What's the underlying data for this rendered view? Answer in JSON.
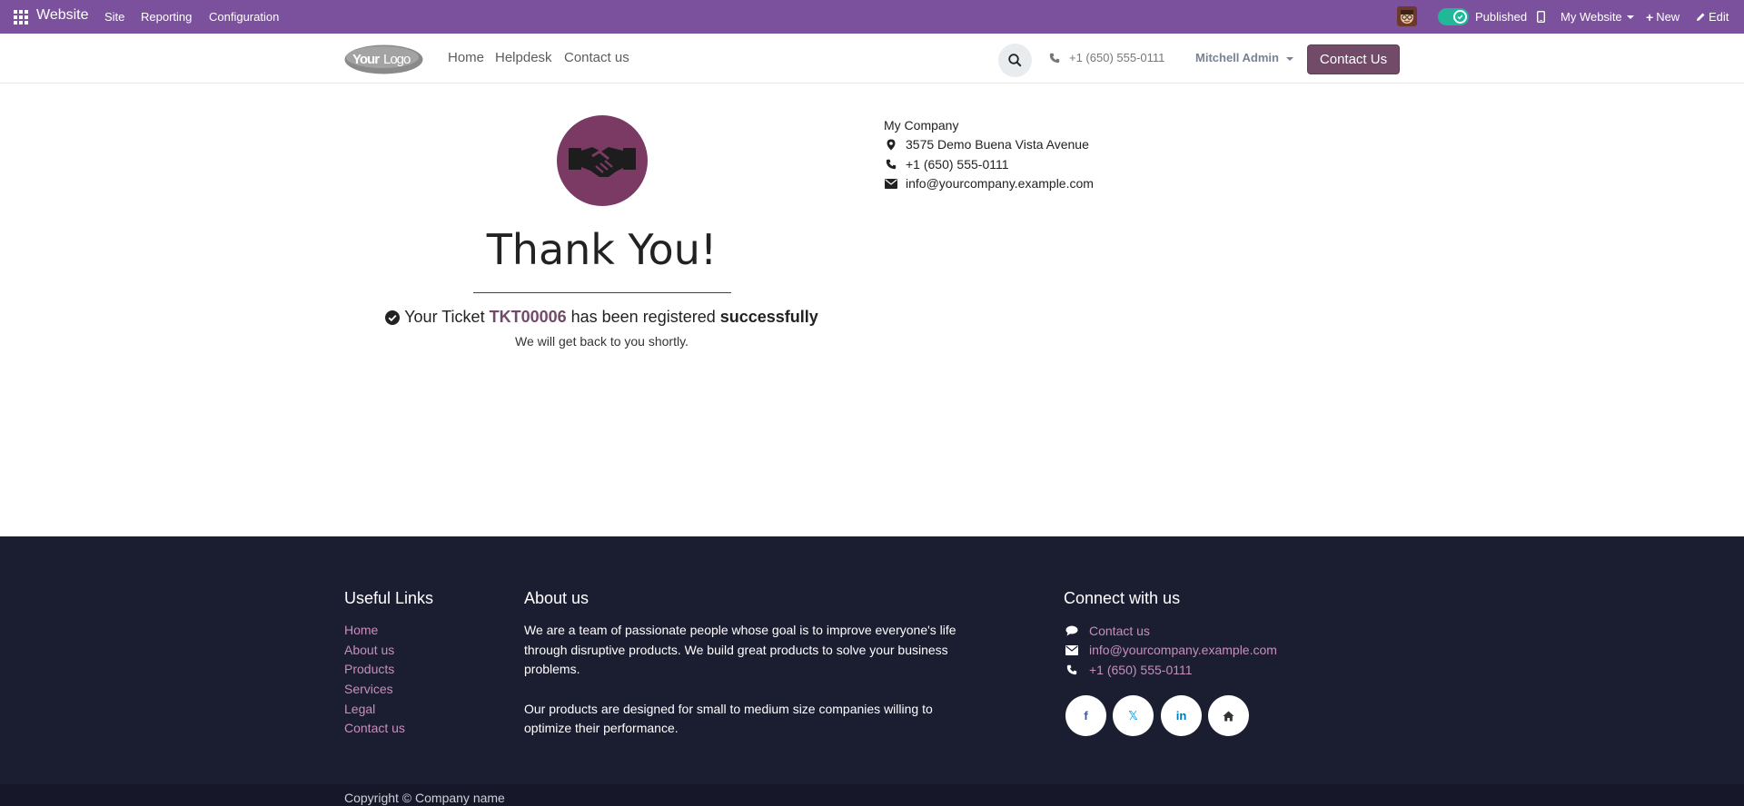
{
  "admin_bar": {
    "app_name": "Website",
    "menu": [
      "Site",
      "Reporting",
      "Configuration"
    ],
    "published_label": "Published",
    "website_selector": "My Website",
    "new_label": "New",
    "edit_label": "Edit"
  },
  "header": {
    "logo_text": "YourLogo",
    "nav": [
      "Home",
      "Helpdesk",
      "Contact us"
    ],
    "phone": "+1 (650) 555-0111",
    "user": "Mitchell Admin",
    "cta": "Contact Us"
  },
  "main": {
    "title": "Thank You!",
    "ticket_prefix": "Your Ticket",
    "ticket_number": "TKT00006",
    "ticket_middle": "has been registered",
    "ticket_suffix": "successfully",
    "subtext": "We will get back to you shortly."
  },
  "company": {
    "name": "My Company",
    "address": "3575 Demo Buena Vista Avenue",
    "phone": "+1 (650) 555-0111",
    "email": "info@yourcompany.example.com"
  },
  "footer": {
    "useful_links_title": "Useful Links",
    "useful_links": [
      "Home",
      "About us",
      "Products",
      "Services",
      "Legal",
      "Contact us"
    ],
    "about_title": "About us",
    "about_p1": "We are a team of passionate people whose goal is to improve everyone's life through disruptive products. We build great products to solve your business problems.",
    "about_p2": "Our products are designed for small to medium size companies willing to optimize their performance.",
    "connect_title": "Connect with us",
    "connect_contact": "Contact us",
    "connect_email": "info@yourcompany.example.com",
    "connect_phone": "+1 (650) 555-0111",
    "social": [
      {
        "name": "facebook-icon",
        "glyph": "f",
        "color": "#3b5998"
      },
      {
        "name": "x-twitter-icon",
        "glyph": "𝕏",
        "color": "#1da1f2"
      },
      {
        "name": "linkedin-icon",
        "glyph": "in",
        "color": "#0077b5"
      },
      {
        "name": "home-icon",
        "glyph": "⌂",
        "color": "#333333"
      }
    ],
    "copyright": "Copyright © Company name"
  },
  "colors": {
    "admin_bar": "#7b519d",
    "primary": "#714b67",
    "footer_bg": "#1b1d31",
    "footer_link": "#c78fbd",
    "toggle_on": "#21b799"
  }
}
